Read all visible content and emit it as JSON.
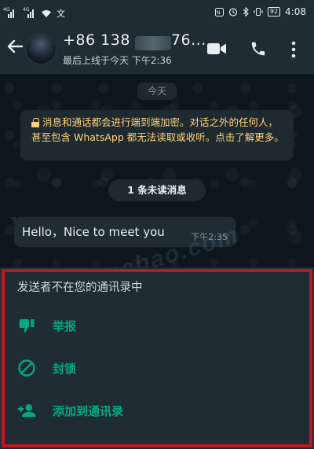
{
  "status_bar": {
    "signal1": "4G",
    "signal2": "4G",
    "extra": "文",
    "battery": "92",
    "time": "4:08"
  },
  "header": {
    "contact_prefix": "+86 138",
    "contact_suffix": "76...",
    "last_seen": "最后上线于今天 下午2:36"
  },
  "chat": {
    "date_chip": "今天",
    "encryption_notice": "消息和通话都会进行端到端加密。对话之外的任何人，甚至包含 WhatsApp 都无法读取或收听。点击了解更多。",
    "unread_label": "1 条未读消息",
    "message": {
      "text": "Hello，Nice to meet you",
      "time": "下午2:35"
    },
    "watermark": "jiemahao.com"
  },
  "panel": {
    "title": "发送者不在您的通讯录中",
    "actions": [
      {
        "label": "举报",
        "icon": "thumb-down-icon"
      },
      {
        "label": "封锁",
        "icon": "block-icon"
      },
      {
        "label": "添加到通讯录",
        "icon": "add-contact-icon"
      }
    ],
    "accent": "#00a884",
    "highlight_border": "#c3151b"
  }
}
